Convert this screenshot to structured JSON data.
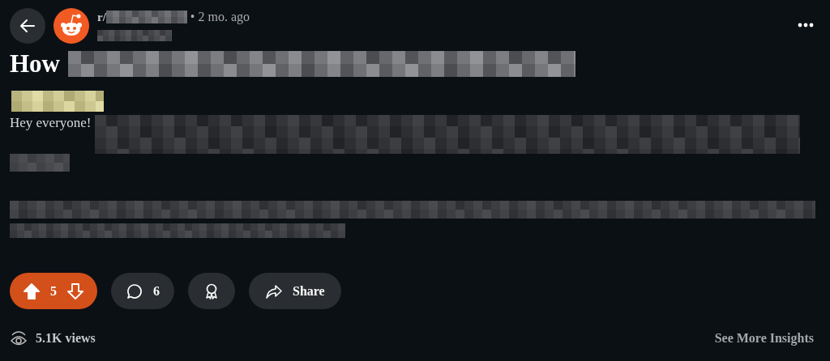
{
  "post": {
    "subreddit_prefix": "r/",
    "time": "• 2 mo. ago",
    "title_start": "How",
    "body_start": "Hey everyone!"
  },
  "actions": {
    "votes": {
      "count": "5",
      "upvoted": true
    },
    "comments": "6",
    "share": "Share"
  },
  "footer": {
    "views": "5.1K views",
    "insights": "See More Insights"
  }
}
